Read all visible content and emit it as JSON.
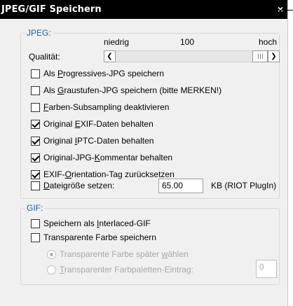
{
  "window": {
    "title": "JPEG/GIF Speichern",
    "close_glyph": "×"
  },
  "jpeg": {
    "legend": "JPEG:",
    "scale": {
      "low": "niedrig",
      "value": "100",
      "high": "hoch"
    },
    "quality_label": "Qualität:",
    "options": [
      {
        "pre": "Als ",
        "acc": "P",
        "post": "rogressives-JPG speichern",
        "checked": false
      },
      {
        "pre": "Als ",
        "acc": "G",
        "post": "raustufen-JPG speichern (bitte MERKEN!)",
        "checked": false
      },
      {
        "pre": "",
        "acc": "F",
        "post": "arben-Subsampling deaktivieren",
        "checked": false
      },
      {
        "pre": "Original ",
        "acc": "E",
        "post": "XIF-Daten behalten",
        "checked": true
      },
      {
        "pre": "Original ",
        "acc": "I",
        "post": "PTC-Daten behalten",
        "checked": true
      },
      {
        "pre": "Original-JPG-",
        "acc": "K",
        "post": "ommentar behalten",
        "checked": true
      },
      {
        "pre": "EXIF-",
        "acc": "O",
        "post": "rientation-Tag zurücksetzen",
        "checked": true
      }
    ],
    "filesize": {
      "pre": "",
      "acc": "D",
      "post": "ateigröße setzen:",
      "checked": false,
      "value": "65.00",
      "unit": "KB (RIOT PlugIn)"
    }
  },
  "gif": {
    "legend": "GIF:",
    "interlaced": {
      "pre": "Speichern als ",
      "acc": "I",
      "post": "nterlaced-GIF",
      "checked": false
    },
    "transparent": {
      "pre": "Transparente Farbe speichern",
      "acc": "",
      "post": "",
      "checked": false
    },
    "radio_later": {
      "pre": "Transparente Farbe später ",
      "acc": "w",
      "post": "ählen",
      "selected": true
    },
    "radio_palette": {
      "pre": "",
      "acc": "T",
      "post": "ransparenter Farbpaletten-Eintrag:",
      "selected": false,
      "value": "0"
    }
  }
}
